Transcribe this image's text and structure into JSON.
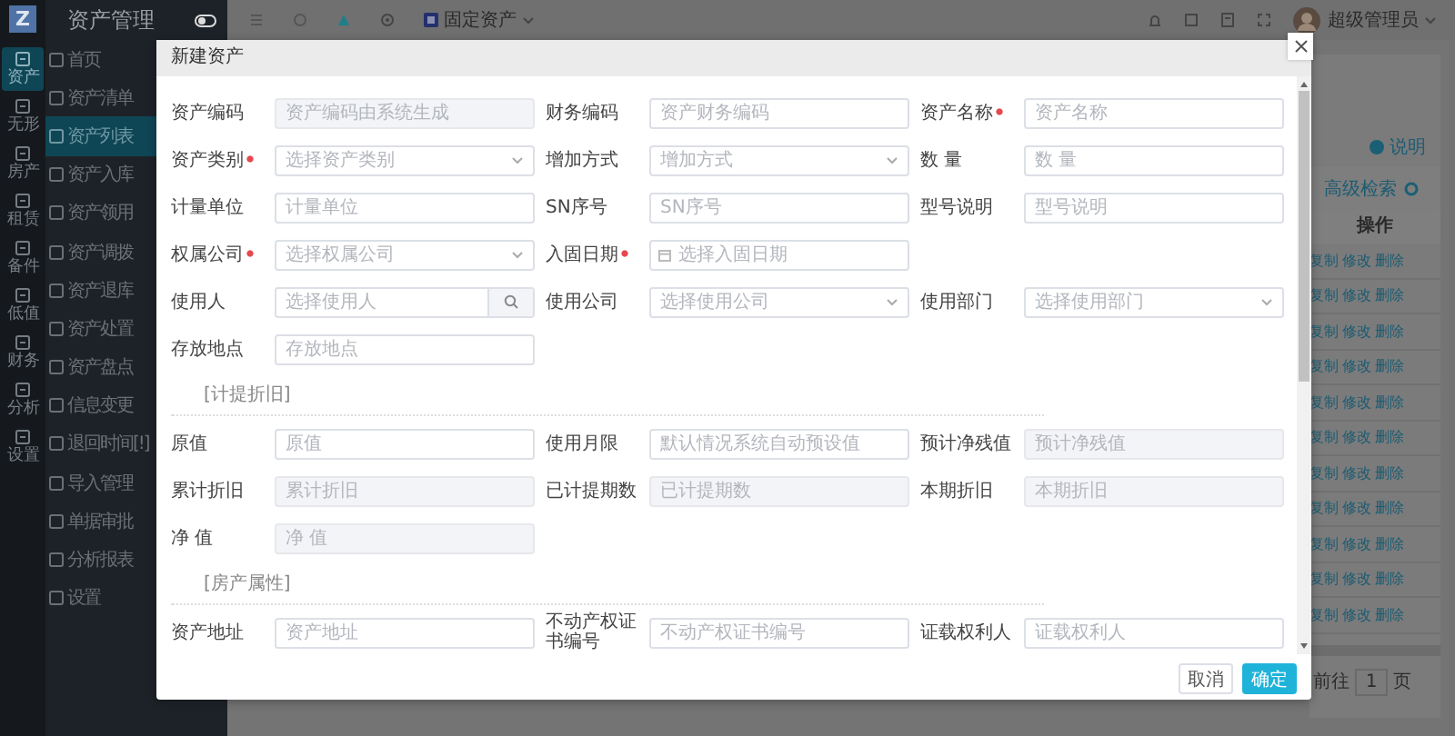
{
  "app": {
    "logo": "Z",
    "title": "资产管理"
  },
  "rail": [
    {
      "label": "资产",
      "selected": true
    },
    {
      "label": "无形",
      "selected": false
    },
    {
      "label": "房产",
      "selected": false
    },
    {
      "label": "租赁",
      "selected": false
    },
    {
      "label": "备件",
      "selected": false
    },
    {
      "label": "低值",
      "selected": false
    },
    {
      "label": "财务",
      "selected": false
    },
    {
      "label": "分析",
      "selected": false
    },
    {
      "label": "设置",
      "selected": false
    }
  ],
  "sidebar": [
    {
      "label": "首页",
      "selected": false
    },
    {
      "label": "资产清单",
      "selected": false
    },
    {
      "label": "资产列表",
      "selected": true
    },
    {
      "label": "资产入库",
      "selected": false
    },
    {
      "label": "资产领用",
      "selected": false
    },
    {
      "label": "资产调拨",
      "selected": false
    },
    {
      "label": "资产退库",
      "selected": false
    },
    {
      "label": "资产处置",
      "selected": false
    },
    {
      "label": "资产盘点",
      "selected": false
    },
    {
      "label": "信息变更",
      "selected": false
    },
    {
      "label": "退回时间[!]",
      "selected": false
    },
    {
      "label": "导入管理",
      "selected": false
    },
    {
      "label": "单据审批",
      "selected": false
    },
    {
      "label": "分析报表",
      "selected": false
    },
    {
      "label": "设置",
      "selected": false
    }
  ],
  "topbar": {
    "module": "固定资产",
    "user": "超级管理员"
  },
  "background": {
    "help": "说明",
    "advanced_search": "高级检索",
    "column": "操作",
    "row_actions": [
      [
        "复制",
        "修改",
        "删除"
      ],
      [
        "复制",
        "修改",
        "删除"
      ],
      [
        "复制",
        "修改",
        "删除"
      ],
      [
        "复制",
        "修改",
        "删除"
      ],
      [
        "复制",
        "修改",
        "删除"
      ],
      [
        "复制",
        "修改",
        "删除"
      ],
      [
        "复制",
        "修改",
        "删除"
      ],
      [
        "复制",
        "修改",
        "删除"
      ],
      [
        "复制",
        "修改",
        "删除"
      ],
      [
        "复制",
        "修改",
        "删除"
      ],
      [
        "复制",
        "修改",
        "删除"
      ]
    ],
    "pagination": {
      "goto": "前往",
      "page": "1",
      "unit": "页"
    }
  },
  "dialog": {
    "title": "新建资产",
    "groups": [
      {
        "rows": [
          [
            {
              "label": "资产编码",
              "required": false,
              "kind": "input",
              "placeholder": "资产编码由系统生成",
              "disabled": true
            },
            {
              "label": "财务编码",
              "required": false,
              "kind": "input",
              "placeholder": "资产财务编码",
              "disabled": false
            },
            {
              "label": "资产名称",
              "required": true,
              "kind": "input",
              "placeholder": "资产名称",
              "disabled": false
            }
          ],
          [
            {
              "label": "资产类别",
              "required": true,
              "kind": "select",
              "placeholder": "选择资产类别",
              "disabled": false
            },
            {
              "label": "增加方式",
              "required": false,
              "kind": "select",
              "placeholder": "增加方式",
              "disabled": false
            },
            {
              "label": "数 量",
              "required": false,
              "kind": "input",
              "placeholder": "数 量",
              "disabled": false
            }
          ],
          [
            {
              "label": "计量单位",
              "required": false,
              "kind": "input",
              "placeholder": "计量单位",
              "disabled": false
            },
            {
              "label": "SN序号",
              "required": false,
              "kind": "input",
              "placeholder": "SN序号",
              "disabled": false
            },
            {
              "label": "型号说明",
              "required": false,
              "kind": "input",
              "placeholder": "型号说明",
              "disabled": false
            }
          ],
          [
            {
              "label": "权属公司",
              "required": true,
              "kind": "select",
              "placeholder": "选择权属公司",
              "disabled": false
            },
            {
              "label": "入固日期",
              "required": true,
              "kind": "date",
              "placeholder": "选择入固日期",
              "disabled": false
            }
          ],
          [
            {
              "label": "使用人",
              "required": false,
              "kind": "search",
              "placeholder": "选择使用人",
              "disabled": false
            },
            {
              "label": "使用公司",
              "required": false,
              "kind": "select",
              "placeholder": "选择使用公司",
              "disabled": false
            },
            {
              "label": "使用部门",
              "required": false,
              "kind": "select",
              "placeholder": "选择使用部门",
              "disabled": false
            }
          ],
          [
            {
              "label": "存放地点",
              "required": false,
              "kind": "input",
              "placeholder": "存放地点",
              "disabled": false
            }
          ]
        ]
      },
      {
        "heading": "[计提折旧]",
        "rows": [
          [
            {
              "label": "原值",
              "required": false,
              "kind": "input",
              "placeholder": "原值",
              "disabled": false
            },
            {
              "label": "使用月限",
              "required": false,
              "kind": "input",
              "placeholder": "默认情况系统自动预设值",
              "disabled": false
            },
            {
              "label": "预计净残值",
              "required": false,
              "kind": "input",
              "placeholder": "预计净残值",
              "disabled": true
            }
          ],
          [
            {
              "label": "累计折旧",
              "required": false,
              "kind": "input",
              "placeholder": "累计折旧",
              "disabled": true
            },
            {
              "label": "已计提期数",
              "required": false,
              "kind": "input",
              "placeholder": "已计提期数",
              "disabled": true
            },
            {
              "label": "本期折旧",
              "required": false,
              "kind": "input",
              "placeholder": "本期折旧",
              "disabled": true
            }
          ],
          [
            {
              "label": "净 值",
              "required": false,
              "kind": "input",
              "placeholder": "净 值",
              "disabled": true
            }
          ]
        ]
      },
      {
        "heading": "[房产属性]",
        "rows": [
          [
            {
              "label": "资产地址",
              "required": false,
              "kind": "input",
              "placeholder": "资产地址",
              "disabled": false
            },
            {
              "label": "不动产权证书编号",
              "required": false,
              "kind": "input",
              "placeholder": "不动产权证书编号",
              "disabled": false
            },
            {
              "label": "证载权利人",
              "required": false,
              "kind": "input",
              "placeholder": "证载权利人",
              "disabled": false
            }
          ]
        ]
      }
    ],
    "buttons": [
      {
        "label": "取消",
        "kind": "default"
      },
      {
        "label": "确定",
        "kind": "primary"
      }
    ]
  }
}
